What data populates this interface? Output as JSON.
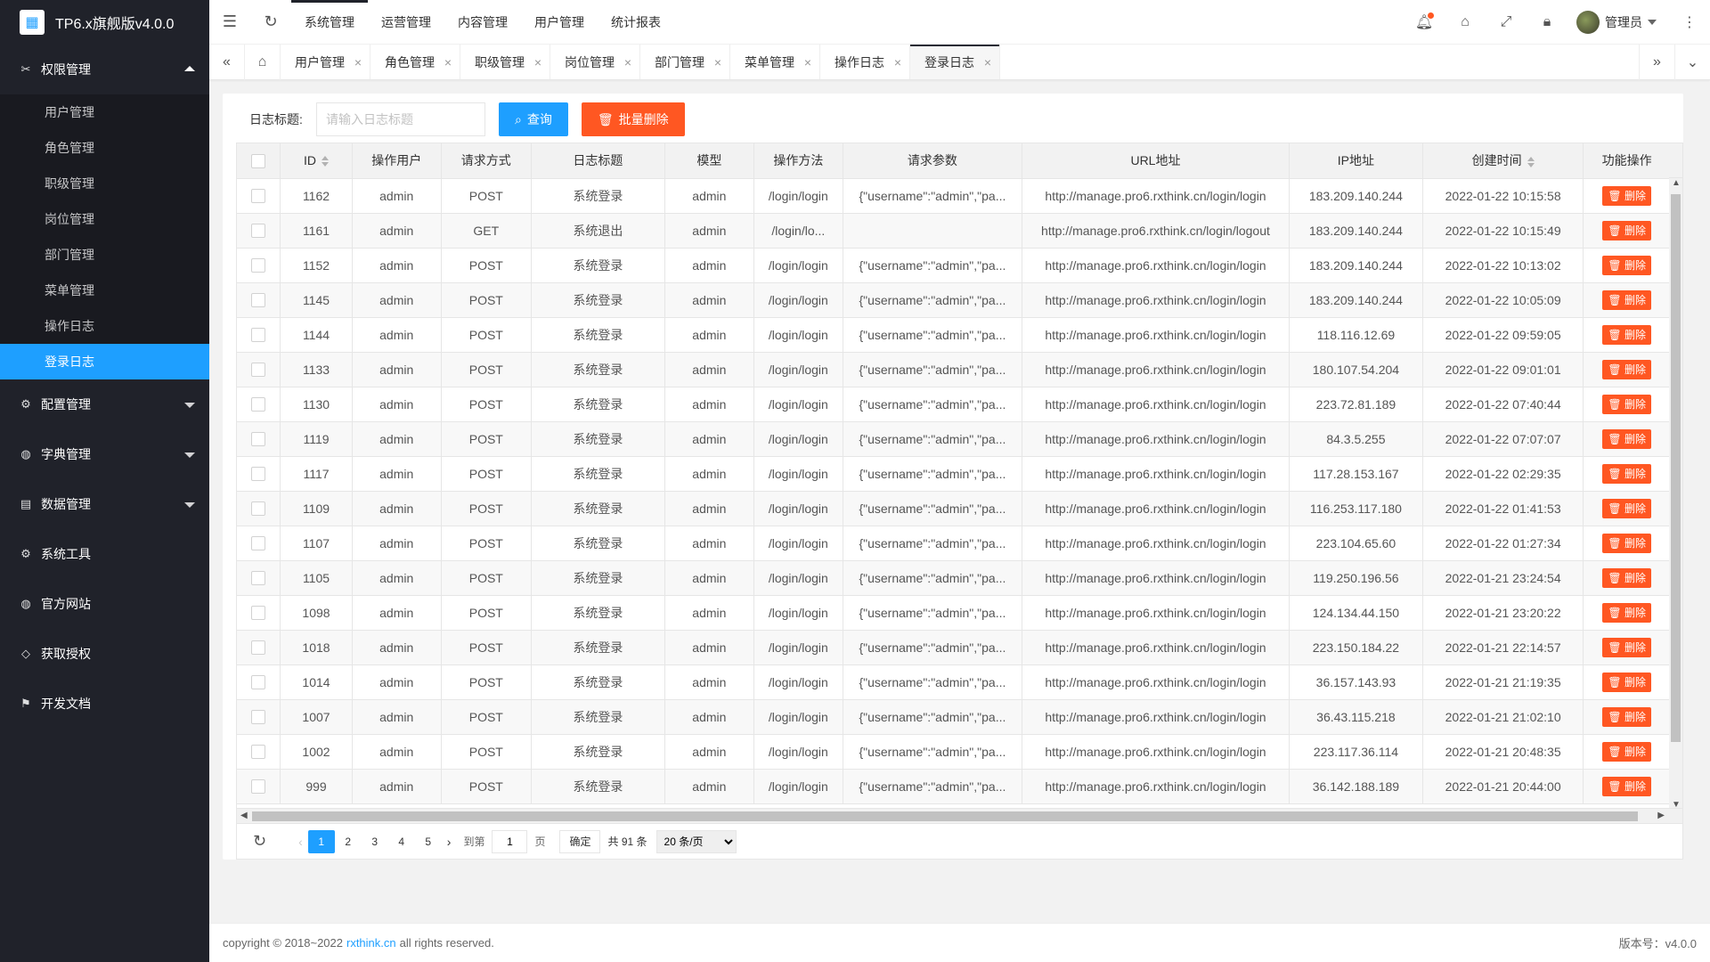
{
  "app": {
    "title": "TP6.x旗舰版v4.0.0"
  },
  "sidebar": {
    "groups": [
      {
        "label": "权限管理",
        "icon": "key-icon",
        "expanded": true,
        "items": [
          "用户管理",
          "角色管理",
          "职级管理",
          "岗位管理",
          "部门管理",
          "菜单管理",
          "操作日志",
          "登录日志"
        ],
        "active_item": "登录日志"
      },
      {
        "label": "配置管理",
        "icon": "gear-icon"
      },
      {
        "label": "字典管理",
        "icon": "globe-icon"
      },
      {
        "label": "数据管理",
        "icon": "book-icon"
      },
      {
        "label": "系统工具",
        "icon": "gear-icon"
      },
      {
        "label": "官方网站",
        "icon": "globe-icon"
      },
      {
        "label": "获取授权",
        "icon": "diamond-icon"
      },
      {
        "label": "开发文档",
        "icon": "flag-icon"
      }
    ]
  },
  "header": {
    "menu": [
      "系统管理",
      "运营管理",
      "内容管理",
      "用户管理",
      "统计报表"
    ],
    "active_menu": "系统管理",
    "user_name": "管理员"
  },
  "tabs": {
    "items": [
      "用户管理",
      "角色管理",
      "职级管理",
      "岗位管理",
      "部门管理",
      "菜单管理",
      "操作日志",
      "登录日志"
    ],
    "active": "登录日志",
    "close_glyph": "×"
  },
  "search": {
    "label": "日志标题:",
    "placeholder": "请输入日志标题",
    "query_button": "查询",
    "batch_delete_button": "批量删除"
  },
  "table": {
    "columns": [
      "ID",
      "操作用户",
      "请求方式",
      "日志标题",
      "模型",
      "操作方法",
      "请求参数",
      "URL地址",
      "IP地址",
      "创建时间",
      "功能操作"
    ],
    "delete_label": "删除",
    "rows": [
      [
        "1162",
        "admin",
        "POST",
        "系统登录",
        "admin",
        "/login/login",
        "{\"username\":\"admin\",\"pa...",
        "http://manage.pro6.rxthink.cn/login/login",
        "183.209.140.244",
        "2022-01-22 10:15:58"
      ],
      [
        "1161",
        "admin",
        "GET",
        "系统退出",
        "admin",
        "/login/lo...",
        "",
        "http://manage.pro6.rxthink.cn/login/logout",
        "183.209.140.244",
        "2022-01-22 10:15:49"
      ],
      [
        "1152",
        "admin",
        "POST",
        "系统登录",
        "admin",
        "/login/login",
        "{\"username\":\"admin\",\"pa...",
        "http://manage.pro6.rxthink.cn/login/login",
        "183.209.140.244",
        "2022-01-22 10:13:02"
      ],
      [
        "1145",
        "admin",
        "POST",
        "系统登录",
        "admin",
        "/login/login",
        "{\"username\":\"admin\",\"pa...",
        "http://manage.pro6.rxthink.cn/login/login",
        "183.209.140.244",
        "2022-01-22 10:05:09"
      ],
      [
        "1144",
        "admin",
        "POST",
        "系统登录",
        "admin",
        "/login/login",
        "{\"username\":\"admin\",\"pa...",
        "http://manage.pro6.rxthink.cn/login/login",
        "118.116.12.69",
        "2022-01-22 09:59:05"
      ],
      [
        "1133",
        "admin",
        "POST",
        "系统登录",
        "admin",
        "/login/login",
        "{\"username\":\"admin\",\"pa...",
        "http://manage.pro6.rxthink.cn/login/login",
        "180.107.54.204",
        "2022-01-22 09:01:01"
      ],
      [
        "1130",
        "admin",
        "POST",
        "系统登录",
        "admin",
        "/login/login",
        "{\"username\":\"admin\",\"pa...",
        "http://manage.pro6.rxthink.cn/login/login",
        "223.72.81.189",
        "2022-01-22 07:40:44"
      ],
      [
        "1119",
        "admin",
        "POST",
        "系统登录",
        "admin",
        "/login/login",
        "{\"username\":\"admin\",\"pa...",
        "http://manage.pro6.rxthink.cn/login/login",
        "84.3.5.255",
        "2022-01-22 07:07:07"
      ],
      [
        "1117",
        "admin",
        "POST",
        "系统登录",
        "admin",
        "/login/login",
        "{\"username\":\"admin\",\"pa...",
        "http://manage.pro6.rxthink.cn/login/login",
        "117.28.153.167",
        "2022-01-22 02:29:35"
      ],
      [
        "1109",
        "admin",
        "POST",
        "系统登录",
        "admin",
        "/login/login",
        "{\"username\":\"admin\",\"pa...",
        "http://manage.pro6.rxthink.cn/login/login",
        "116.253.117.180",
        "2022-01-22 01:41:53"
      ],
      [
        "1107",
        "admin",
        "POST",
        "系统登录",
        "admin",
        "/login/login",
        "{\"username\":\"admin\",\"pa...",
        "http://manage.pro6.rxthink.cn/login/login",
        "223.104.65.60",
        "2022-01-22 01:27:34"
      ],
      [
        "1105",
        "admin",
        "POST",
        "系统登录",
        "admin",
        "/login/login",
        "{\"username\":\"admin\",\"pa...",
        "http://manage.pro6.rxthink.cn/login/login",
        "119.250.196.56",
        "2022-01-21 23:24:54"
      ],
      [
        "1098",
        "admin",
        "POST",
        "系统登录",
        "admin",
        "/login/login",
        "{\"username\":\"admin\",\"pa...",
        "http://manage.pro6.rxthink.cn/login/login",
        "124.134.44.150",
        "2022-01-21 23:20:22"
      ],
      [
        "1018",
        "admin",
        "POST",
        "系统登录",
        "admin",
        "/login/login",
        "{\"username\":\"admin\",\"pa...",
        "http://manage.pro6.rxthink.cn/login/login",
        "223.150.184.22",
        "2022-01-21 22:14:57"
      ],
      [
        "1014",
        "admin",
        "POST",
        "系统登录",
        "admin",
        "/login/login",
        "{\"username\":\"admin\",\"pa...",
        "http://manage.pro6.rxthink.cn/login/login",
        "36.157.143.93",
        "2022-01-21 21:19:35"
      ],
      [
        "1007",
        "admin",
        "POST",
        "系统登录",
        "admin",
        "/login/login",
        "{\"username\":\"admin\",\"pa...",
        "http://manage.pro6.rxthink.cn/login/login",
        "36.43.115.218",
        "2022-01-21 21:02:10"
      ],
      [
        "1002",
        "admin",
        "POST",
        "系统登录",
        "admin",
        "/login/login",
        "{\"username\":\"admin\",\"pa...",
        "http://manage.pro6.rxthink.cn/login/login",
        "223.117.36.114",
        "2022-01-21 20:48:35"
      ],
      [
        "999",
        "admin",
        "POST",
        "系统登录",
        "admin",
        "/login/login",
        "{\"username\":\"admin\",\"pa...",
        "http://manage.pro6.rxthink.cn/login/login",
        "36.142.188.189",
        "2022-01-21 20:44:00"
      ]
    ]
  },
  "pager": {
    "pages": [
      "1",
      "2",
      "3",
      "4",
      "5"
    ],
    "current": "1",
    "goto_label": "到第",
    "page_unit": "页",
    "goto_value": "1",
    "confirm": "确定",
    "total": "共 91 条",
    "page_size": "20 条/页"
  },
  "footer": {
    "copyright_prefix": "copyright © 2018~2022",
    "link": "rxthink.cn",
    "copyright_suffix": "all rights reserved.",
    "version": "版本号：v4.0.0"
  }
}
